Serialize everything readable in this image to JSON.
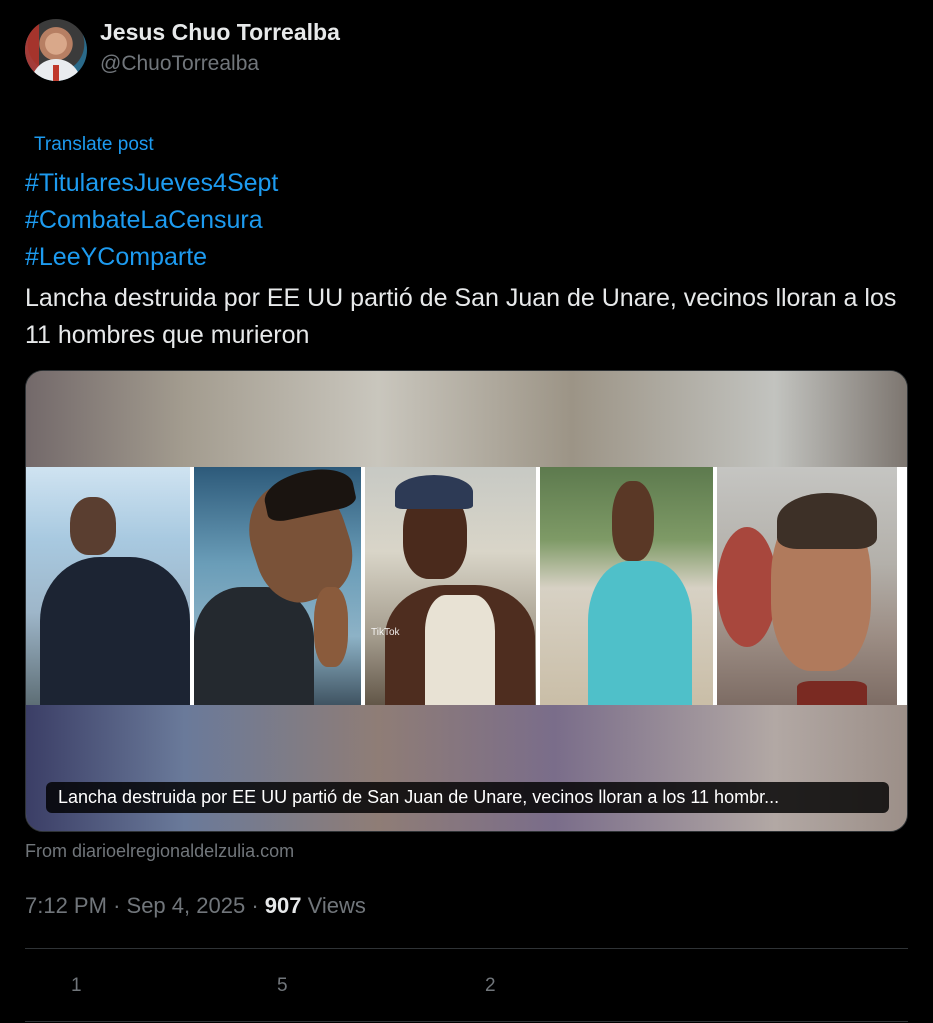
{
  "author": {
    "name": "Jesus Chuo Torrealba",
    "handle": "@ChuoTorrealba"
  },
  "post": {
    "translate_label": "Translate post",
    "hashtags": [
      "#TitularesJueves4Sept",
      "#CombateLaCensura",
      "#LeeYComparte"
    ],
    "text": "Lancha destruida por EE UU partió de San Juan de Unare, vecinos lloran a los 11 hombres que murieron"
  },
  "link_card": {
    "caption": "Lancha destruida por EE UU partió de San Juan de Unare, vecinos lloran a los 11 hombr...",
    "source": "From diarioelregionaldelzulia.com",
    "watermark": "TikTok"
  },
  "meta": {
    "time": "7:12 PM",
    "separator": "·",
    "date": "Sep 4, 2025",
    "views_count": "907",
    "views_label": "Views"
  },
  "actions": {
    "reply_count": "1",
    "retweet_count": "5",
    "like_count": "2"
  },
  "colors": {
    "background": "#000000",
    "link": "#1d9bf0",
    "text": "#e7e9ea",
    "muted": "#71767b",
    "border": "#2f3336"
  }
}
